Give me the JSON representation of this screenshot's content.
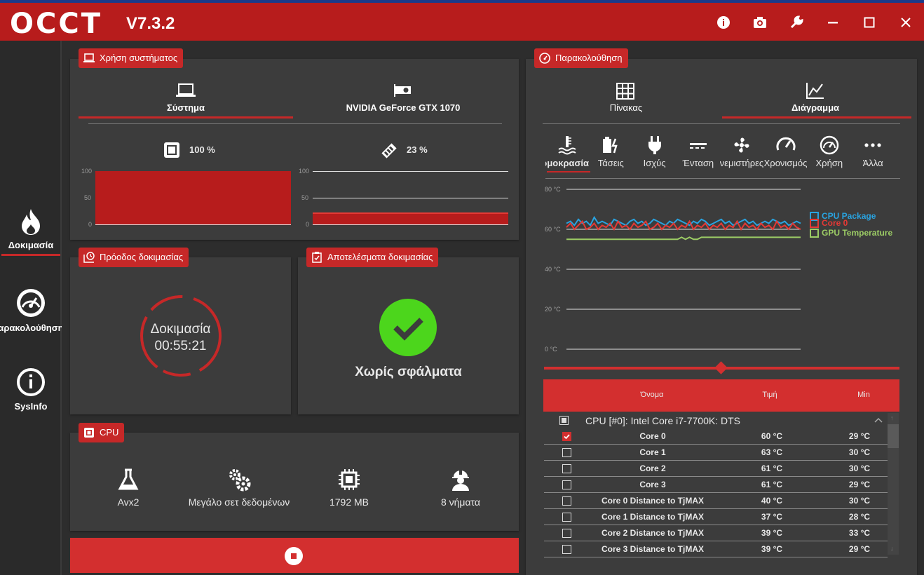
{
  "app": {
    "logo": "OCCT",
    "version": "V7.3.2",
    "top_buttons": [
      "info-icon",
      "camera-icon",
      "wrench-icon",
      "minimize-icon",
      "maximize-icon",
      "close-icon"
    ],
    "accent": "#c62828"
  },
  "sidebar": {
    "items": [
      {
        "label": "Δοκιμασία",
        "icon": "flame-icon",
        "active": true
      },
      {
        "label": "Παρακολούθηση",
        "icon": "gauge-icon"
      },
      {
        "label": "SysInfo",
        "icon": "info-circle-icon"
      }
    ]
  },
  "usage": {
    "title": "Χρήση συστήματος",
    "tabs": [
      "Σύστημα",
      "NVIDIA GeForce GTX 1070"
    ],
    "cpu_value": "100 %",
    "gpu_value": "23 %",
    "cpu_fraction": 1.0,
    "gpu_fraction": 0.23,
    "axis": [
      "100",
      "50",
      "0"
    ]
  },
  "progress": {
    "title": "Πρόοδος δοκιμασίας",
    "label": "Δοκιμασία",
    "time": "00:55:21"
  },
  "results": {
    "title": "Αποτελέσματα δοκιμασίας",
    "status": "Χωρίς σφάλματα"
  },
  "cpu": {
    "title": "CPU",
    "items": [
      {
        "label": "Avx2",
        "icon": "flask-icon"
      },
      {
        "label": "Μεγάλο σετ δεδομένων",
        "icon": "gears-icon"
      },
      {
        "label": "1792 MB",
        "icon": "chip-icon"
      },
      {
        "label": "8 νήματα",
        "icon": "worker-icon"
      }
    ]
  },
  "monitor": {
    "title": "Παρακολούθηση",
    "tabs": [
      "Πίνακας",
      "Διάγραμμα"
    ],
    "categories": [
      "Θερμοκρασία",
      "Τάσεις",
      "Ισχύς",
      "Ένταση",
      "Ανεμιστήρες",
      "Χρονισμός",
      "Χρήση",
      "Άλλα"
    ],
    "chart_labels": [
      "80 °C",
      "60 °C",
      "40 °C",
      "20 °C",
      "0 °C"
    ],
    "legend": [
      {
        "name": "CPU Package",
        "color": "#29a3e0"
      },
      {
        "name": "Core 0",
        "color": "#e53935"
      },
      {
        "name": "GPU Temperature",
        "color": "#9ccc65"
      }
    ],
    "table_headers": [
      "Όνομα",
      "Τιμή",
      "Min"
    ],
    "group": "CPU [#0]: Intel Core i7-7700K: DTS",
    "rows": [
      {
        "name": "Core 0",
        "value": "60 °C",
        "min": "29 °C",
        "checked": true
      },
      {
        "name": "Core 1",
        "value": "63 °C",
        "min": "30 °C"
      },
      {
        "name": "Core 2",
        "value": "61 °C",
        "min": "30 °C"
      },
      {
        "name": "Core 3",
        "value": "61 °C",
        "min": "29 °C"
      },
      {
        "name": "Core 0 Distance to TjMAX",
        "value": "40 °C",
        "min": "30 °C"
      },
      {
        "name": "Core 1 Distance to TjMAX",
        "value": "37 °C",
        "min": "28 °C"
      },
      {
        "name": "Core 2 Distance to TjMAX",
        "value": "39 °C",
        "min": "33 °C"
      },
      {
        "name": "Core 3 Distance to TjMAX",
        "value": "39 °C",
        "min": "29 °C"
      }
    ]
  },
  "chart_data": {
    "type": "line",
    "ylim": [
      0,
      80
    ],
    "series": [
      {
        "name": "CPU Package",
        "values": [
          63,
          64,
          62,
          65,
          63,
          64,
          62,
          66,
          63,
          64,
          63,
          62,
          65,
          64,
          63,
          62,
          64,
          65,
          63,
          64,
          62,
          63,
          65,
          64,
          63,
          62,
          64,
          63,
          65,
          64,
          63,
          62,
          64,
          63,
          65,
          64,
          62,
          63,
          64,
          65,
          63,
          64,
          62,
          63,
          64,
          65,
          63,
          64,
          62,
          63,
          64,
          63,
          65,
          64,
          63,
          64,
          62,
          63,
          64,
          63
        ]
      },
      {
        "name": "Core 0",
        "values": [
          61,
          63,
          60,
          62,
          64,
          60,
          61,
          63,
          60,
          62,
          61,
          63,
          60,
          64,
          61,
          62,
          60,
          63,
          61,
          62,
          64,
          60,
          61,
          63,
          60,
          62,
          61,
          63,
          60,
          62,
          61,
          64,
          60,
          62,
          61,
          63,
          60,
          62,
          61,
          63,
          60,
          62,
          61,
          64,
          60,
          63,
          61,
          62,
          60,
          63,
          61,
          62,
          60,
          64,
          61,
          62,
          60,
          63,
          61,
          60
        ]
      },
      {
        "name": "GPU Temperature",
        "values": [
          55,
          55,
          55,
          55,
          55,
          55,
          55,
          55,
          55,
          55,
          55,
          55,
          55,
          55,
          55,
          55,
          55,
          55,
          55,
          55,
          55,
          55,
          55,
          55,
          55,
          55,
          55,
          55,
          55,
          56,
          55,
          56,
          55,
          55,
          56,
          56,
          56,
          56,
          56,
          56,
          56,
          56,
          56,
          56,
          56,
          56,
          56,
          56,
          56,
          56,
          56,
          56,
          56,
          56,
          56,
          56,
          56,
          56,
          56,
          56
        ]
      }
    ]
  }
}
